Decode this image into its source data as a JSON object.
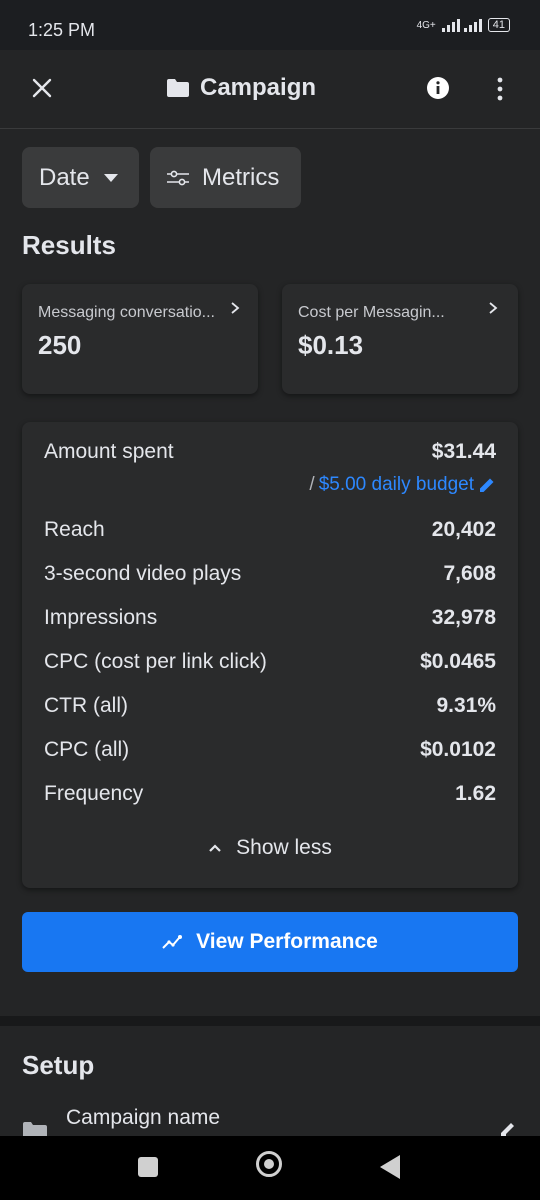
{
  "status_bar": {
    "time": "1:25 PM",
    "network": "4G+",
    "battery": "41"
  },
  "header": {
    "title": "Campaign",
    "title_icon": "folder-icon"
  },
  "filters": {
    "date_label": "Date",
    "metrics_label": "Metrics"
  },
  "results": {
    "heading": "Results",
    "cards": [
      {
        "label": "Messaging conversatio...",
        "value": "250"
      },
      {
        "label": "Cost per Messagin...",
        "value": "$0.13"
      }
    ]
  },
  "metrics": {
    "amount_spent": {
      "label": "Amount spent",
      "value": "$31.44"
    },
    "budget": {
      "prefix": "/",
      "text": "$5.00 daily budget"
    },
    "rows": [
      {
        "label": "Reach",
        "value": "20,402"
      },
      {
        "label": "3-second video plays",
        "value": "7,608"
      },
      {
        "label": "Impressions",
        "value": "32,978"
      },
      {
        "label": "CPC (cost per link click)",
        "value": "$0.0465"
      },
      {
        "label": "CTR (all)",
        "value": "9.31%"
      },
      {
        "label": "CPC (all)",
        "value": "$0.0102"
      },
      {
        "label": "Frequency",
        "value": "1.62"
      }
    ],
    "show_less": "Show less"
  },
  "view_performance": "View Performance",
  "setup": {
    "heading": "Setup",
    "campaign_name_label": "Campaign name"
  },
  "colors": {
    "background": "#242526",
    "accent": "#1877f2",
    "link": "#2d88ff",
    "card": "#2a2b2c"
  }
}
